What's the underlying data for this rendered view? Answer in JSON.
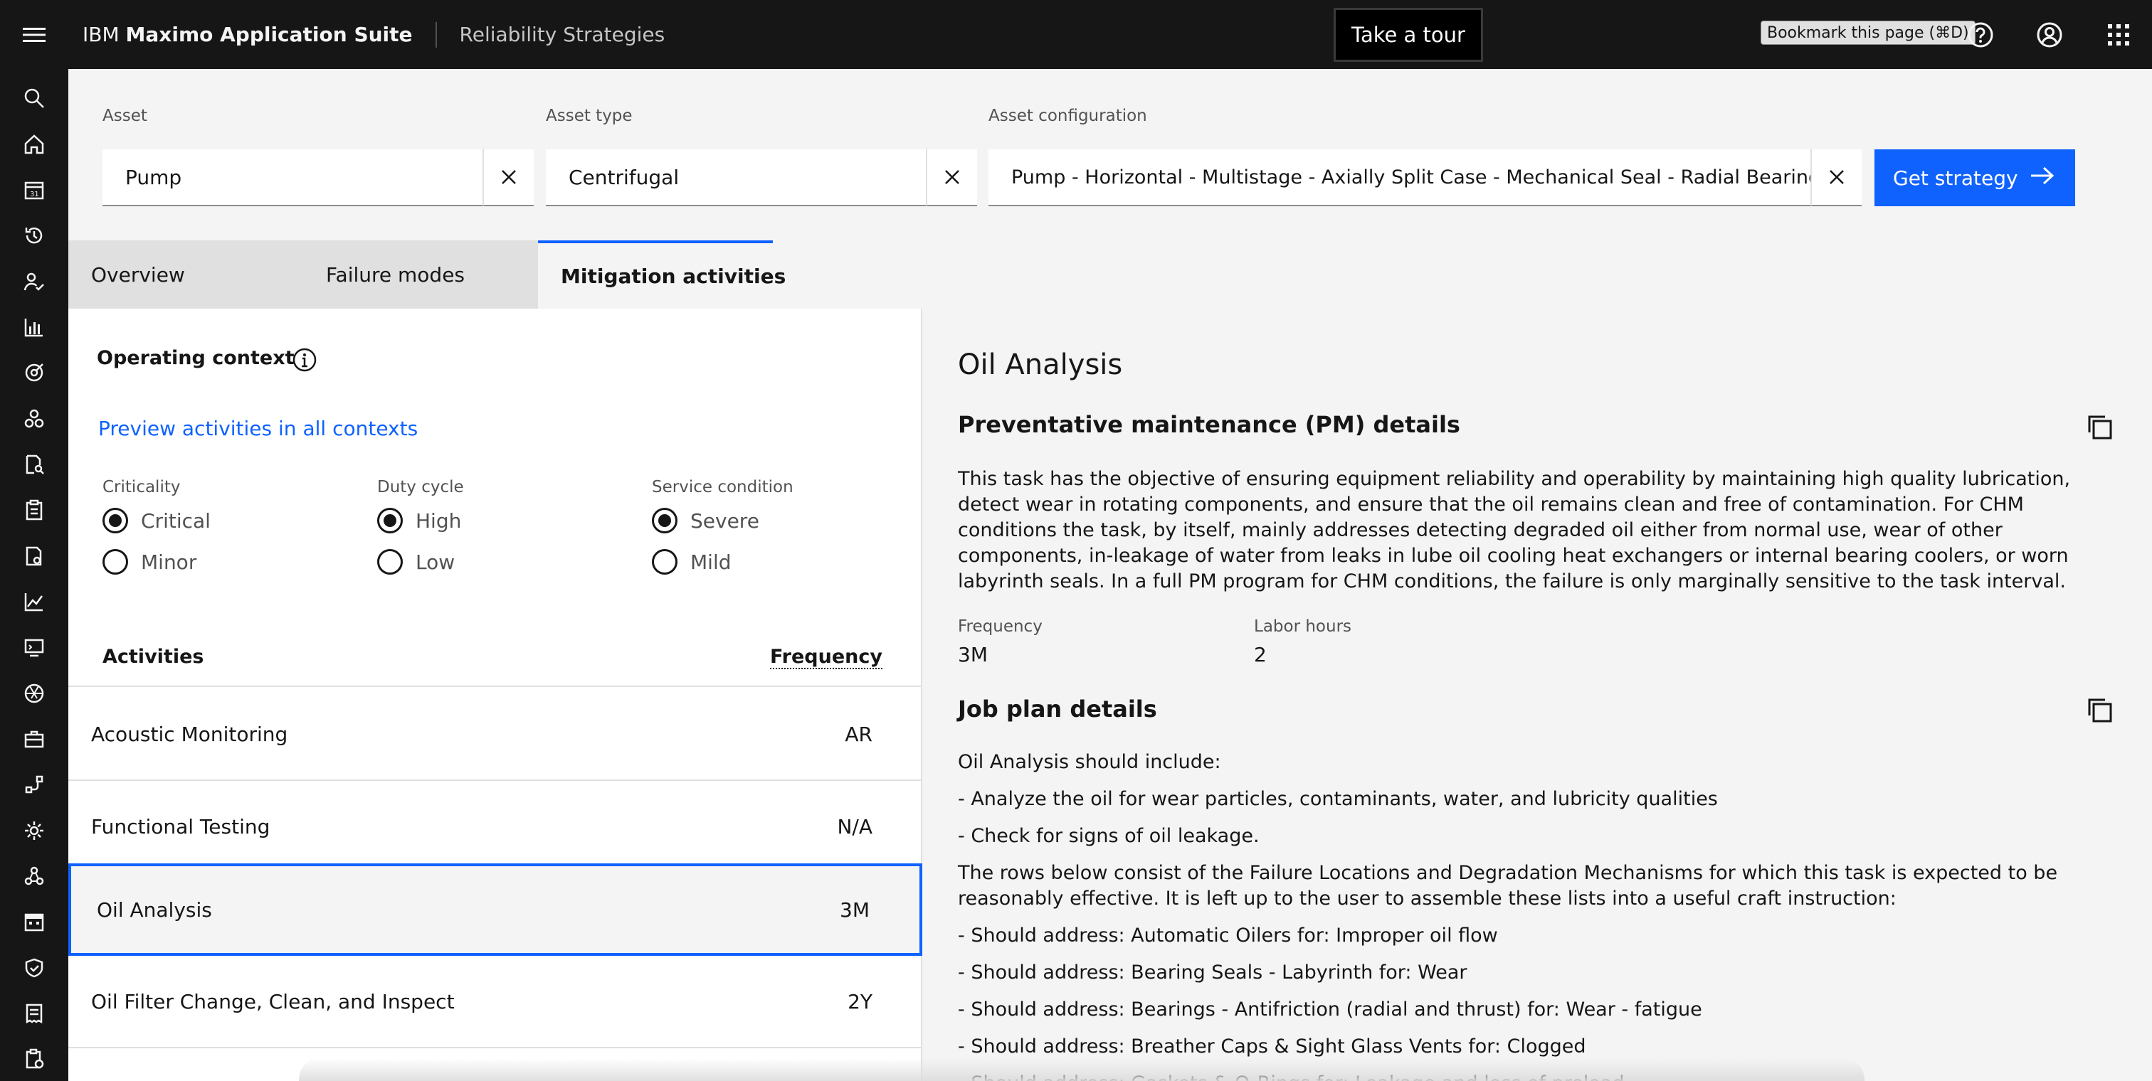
{
  "header": {
    "brand_prefix": "IBM ",
    "brand_bold": "Maximo Application Suite",
    "app_name": "Reliability Strategies",
    "tour_label": "Take a tour",
    "bookmark_tooltip": "Bookmark this page (⌘D)",
    "icons": [
      "menu-icon",
      "help-icon",
      "user-avatar-icon",
      "app-switcher-icon"
    ]
  },
  "siderail": {
    "icons": [
      "search-icon",
      "home-icon",
      "calendar-icon",
      "history-icon",
      "user-check-icon",
      "bar-chart-icon",
      "gauge-icon",
      "hierarchy-icon",
      "document-search-icon",
      "clipboard-icon",
      "report-icon",
      "line-chart-icon",
      "monitor-icon",
      "aperture-icon",
      "toolbox-icon",
      "route-icon",
      "settings-icon",
      "model-icon",
      "calendar-grid-icon",
      "shield-check-icon",
      "receipt-icon",
      "task-icon"
    ]
  },
  "filters": {
    "asset_label": "Asset",
    "asset_value": "Pump",
    "asset_type_label": "Asset type",
    "asset_type_value": "Centrifugal",
    "config_label": "Asset configuration",
    "config_value": "Pump - Horizontal - Multistage - Axially Split Case - Mechanical Seal - Radial Bearing",
    "get_strategy_label": "Get strategy"
  },
  "tabs": [
    {
      "label": "Overview"
    },
    {
      "label": "Failure modes"
    },
    {
      "label": "Mitigation activities"
    }
  ],
  "context": {
    "heading": "Operating context",
    "preview_link": "Preview activities in all contexts",
    "criticality": {
      "label": "Criticality",
      "options": [
        "Critical",
        "Minor"
      ],
      "selected": "Critical"
    },
    "duty_cycle": {
      "label": "Duty cycle",
      "options": [
        "High",
        "Low"
      ],
      "selected": "High"
    },
    "service_condition": {
      "label": "Service condition",
      "options": [
        "Severe",
        "Mild"
      ],
      "selected": "Severe"
    }
  },
  "activities": {
    "col_activity": "Activities",
    "col_frequency": "Frequency",
    "rows": [
      {
        "name": "Acoustic Monitoring",
        "frequency": "AR"
      },
      {
        "name": "Functional Testing",
        "frequency": "N/A"
      },
      {
        "name": "Oil Analysis",
        "frequency": "3M"
      },
      {
        "name": "Oil Filter Change, Clean, and Inspect",
        "frequency": "2Y"
      }
    ],
    "selected": "Oil Analysis"
  },
  "detail": {
    "title": "Oil Analysis",
    "pm_heading": "Preventative maintenance (PM) details",
    "pm_description": "This task has the objective of ensuring equipment reliability and operability by maintaining high quality lubrication, detect wear in rotating components, and ensure that the oil remains clean and free of contamination. For CHM conditions the task, by itself, mainly addresses detecting degraded oil either from normal use, wear of other components, in-leakage of water from leaks in lube oil cooling heat exchangers or internal bearing coolers, or worn labyrinth seals. In a full PM program for CHM conditions, the failure is only marginally sensitive to the task interval.",
    "frequency_label": "Frequency",
    "frequency_value": "3M",
    "labor_label": "Labor hours",
    "labor_value": "2",
    "job_plan_heading": "Job plan details",
    "jp_intro": "Oil Analysis should include:",
    "jp_item1": "- Analyze the oil for wear particles, contaminants, water, and lubricity qualities",
    "jp_item2": "- Check for signs of oil leakage.",
    "jp_rows_text": "The rows below consist of the Failure Locations and Degradation Mechanisms for which this task is expected to be reasonably effective. It is left up to the user to assemble these lists into a useful craft instruction:",
    "addr1": "- Should address: Automatic Oilers for: Improper oil flow",
    "addr2": "- Should address: Bearing Seals - Labyrinth for: Wear",
    "addr3": "- Should address: Bearings - Antifriction (radial and thrust) for: Wear - fatigue",
    "addr4": "- Should address: Breather Caps & Sight Glass Vents for: Clogged",
    "addr5": "- Should address: Gaskets & O-Rings for: Leakage and loss of preload"
  }
}
